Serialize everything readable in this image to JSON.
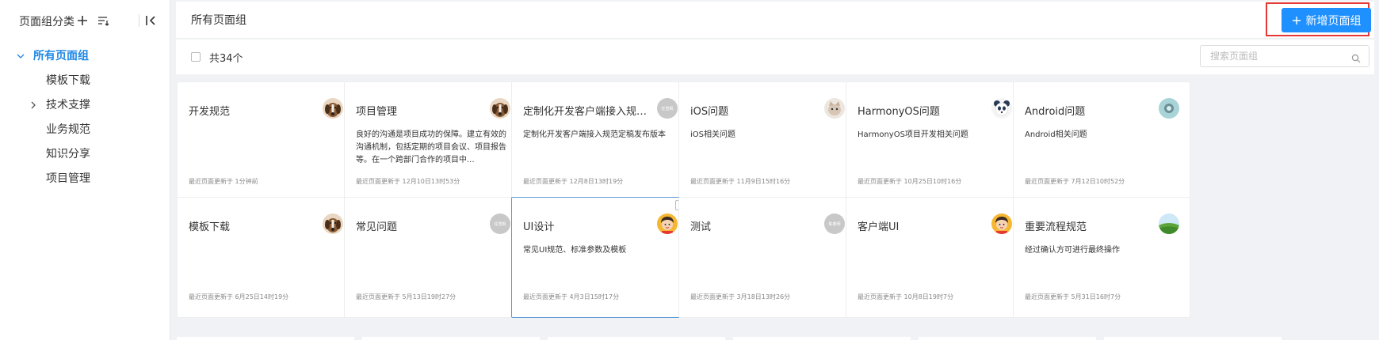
{
  "sidebar": {
    "title": "页面组分类",
    "tree": {
      "root": "所有页面组",
      "children": [
        {
          "label": "模板下载",
          "expandable": false
        },
        {
          "label": "技术支撑",
          "expandable": true
        },
        {
          "label": "业务规范",
          "expandable": false
        },
        {
          "label": "知识分享",
          "expandable": false
        },
        {
          "label": "项目管理",
          "expandable": false
        }
      ]
    }
  },
  "header": {
    "title": "所有页面组",
    "add_button": "新增页面组"
  },
  "toolbar": {
    "count": "共34个",
    "search_placeholder": "搜索页面组"
  },
  "colors": {
    "accent": "#1e90ff",
    "highlight_frame": "#e53935",
    "selected_border": "#5b9bd5"
  },
  "cards": [
    {
      "title": "开发规范",
      "desc": "",
      "date": "最近页面更新于 1分钟前",
      "avatar": "dog-avatar"
    },
    {
      "title": "项目管理",
      "desc": "良好的沟通是项目成功的保障。建立有效的沟通机制，包括定期的项目会议、项目报告等。在一个跨部门合作的项目中...",
      "date": "最近页面更新于 12月10日13时53分",
      "avatar": "dog-avatar"
    },
    {
      "title": "定制化开发客户端接入规范...",
      "desc": "定制化开发客户端接入规范定稿发布版本",
      "date": "最近页面更新于 12月8日13时19分",
      "avatar": "gray-avatar",
      "avatar_text": "任雪枫"
    },
    {
      "title": "iOS问题",
      "desc": "iOS相关问题",
      "date": "最近页面更新于 11月9日15时16分",
      "avatar": "cat-avatar"
    },
    {
      "title": "HarmonyOS问题",
      "desc": "HarmonyOS项目开发相关问题",
      "date": "最近页面更新于 10月25日10时16分",
      "avatar": "panda-avatar"
    },
    {
      "title": "Android问题",
      "desc": "Android相关问题",
      "date": "最近页面更新于 7月12日10时52分",
      "avatar": "teal-avatar"
    },
    {
      "title": "模板下载",
      "desc": "",
      "date": "最近页面更新于 6月25日14时19分",
      "avatar": "dog-avatar"
    },
    {
      "title": "常见问题",
      "desc": "",
      "date": "最近页面更新于 5月13日19时27分",
      "avatar": "gray-avatar",
      "avatar_text": "任雪枫"
    },
    {
      "title": "UI设计",
      "desc": "常见UI规范、标准参数及模板",
      "date": "最近页面更新于 4月3日15时17分",
      "avatar": "person-avatar",
      "selected": true
    },
    {
      "title": "测试",
      "desc": "",
      "date": "最近页面更新于 3月18日13时26分",
      "avatar": "gray-avatar",
      "avatar_text": "陈春明"
    },
    {
      "title": "客户端UI",
      "desc": "",
      "date": "最近页面更新于 10月8日19时7分",
      "avatar": "person-avatar"
    },
    {
      "title": "重要流程规范",
      "desc": "经过确认方可进行最终操作",
      "date": "最近页面更新于 5月31日16时7分",
      "avatar": "landscape-avatar"
    }
  ]
}
